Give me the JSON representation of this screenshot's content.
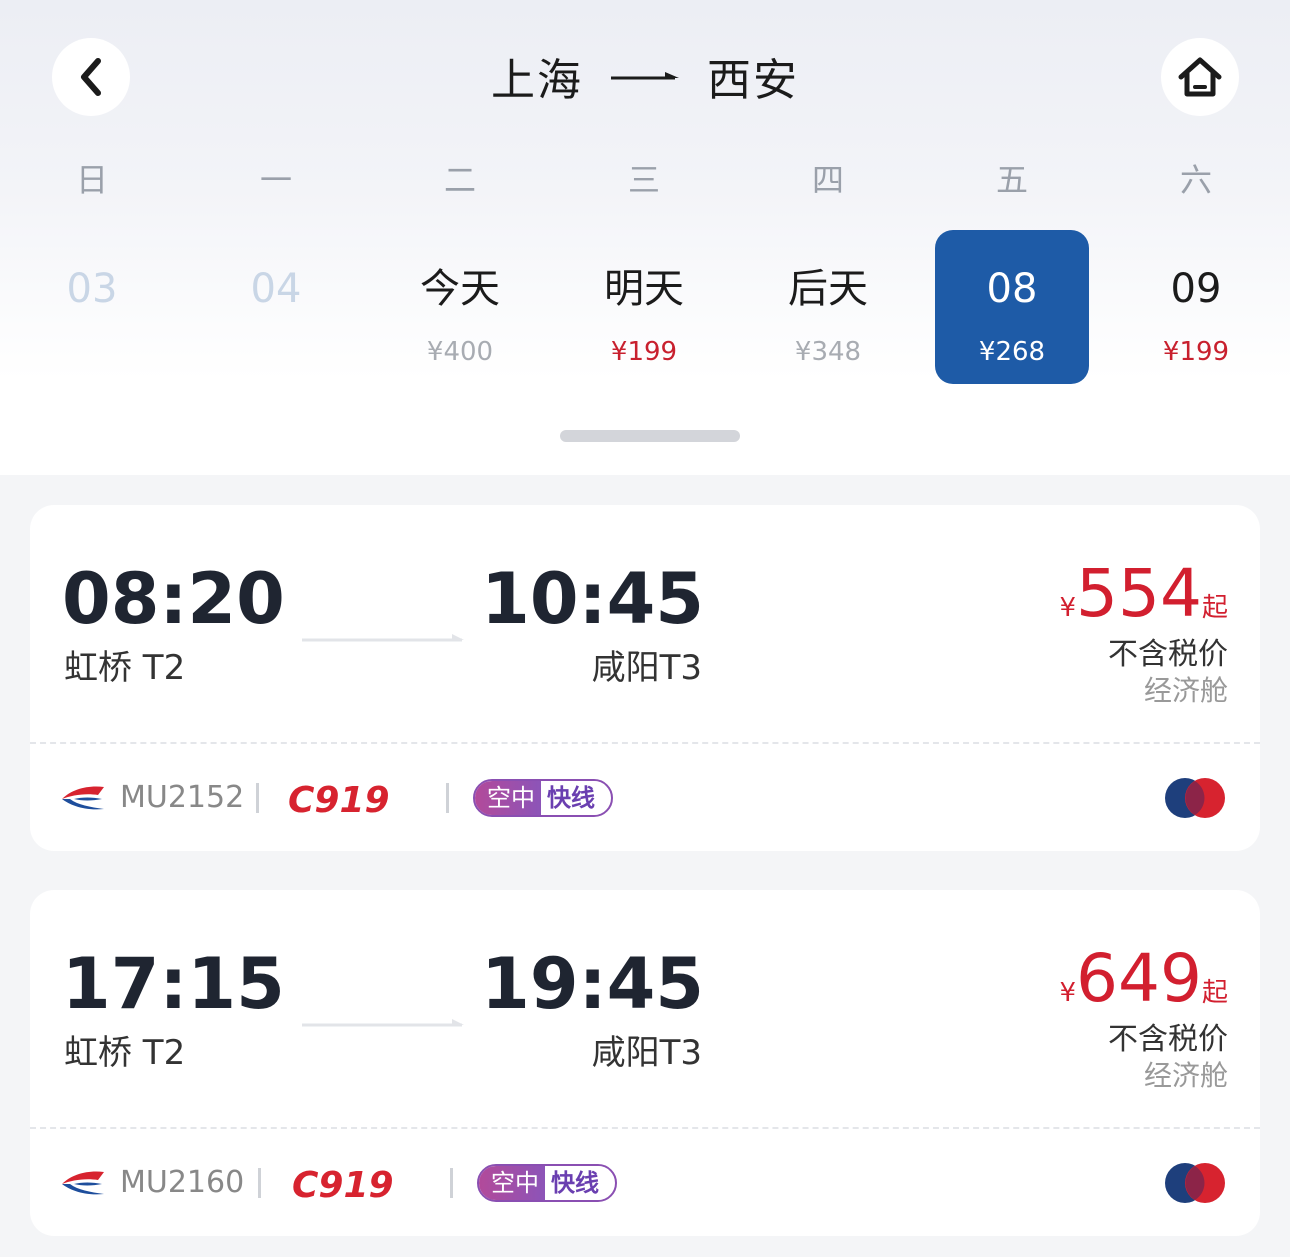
{
  "header": {
    "origin": "上海",
    "destination": "西安"
  },
  "calendar": {
    "weekdays": [
      "日",
      "一",
      "二",
      "三",
      "四",
      "五",
      "六"
    ],
    "dates": [
      {
        "label": "03",
        "price": ""
      },
      {
        "label": "04",
        "price": ""
      },
      {
        "label": "今天",
        "price": "¥400"
      },
      {
        "label": "明天",
        "price": "¥199"
      },
      {
        "label": "后天",
        "price": "¥348"
      },
      {
        "label": "08",
        "price": "¥268"
      },
      {
        "label": "09",
        "price": "¥199"
      }
    ]
  },
  "flights": [
    {
      "dep_time": "08:20",
      "dep_airport": "虹桥 T2",
      "arr_time": "10:45",
      "arr_airport": "咸阳T3",
      "currency": "¥",
      "price": "554",
      "price_suffix": "起",
      "tax_note": "不含税价",
      "cabin": "经济舱",
      "flight_no": "MU2152",
      "aircraft": "C919",
      "tag_part1": "空中",
      "tag_part2": "快线"
    },
    {
      "dep_time": "17:15",
      "dep_airport": "虹桥 T2",
      "arr_time": "19:45",
      "arr_airport": "咸阳T3",
      "currency": "¥",
      "price": "649",
      "price_suffix": "起",
      "tax_note": "不含税价",
      "cabin": "经济舱",
      "flight_no": "MU2160",
      "aircraft": "C919",
      "tag_part1": "空中",
      "tag_part2": "快线"
    }
  ],
  "colors": {
    "accent_blue": "#1e5ba7",
    "price_red": "#d21f2f"
  },
  "icons": {
    "back": "chevron-left-icon",
    "home": "home-icon",
    "airline": "china-eastern-logo-icon",
    "payment": "card-scheme-icon"
  }
}
